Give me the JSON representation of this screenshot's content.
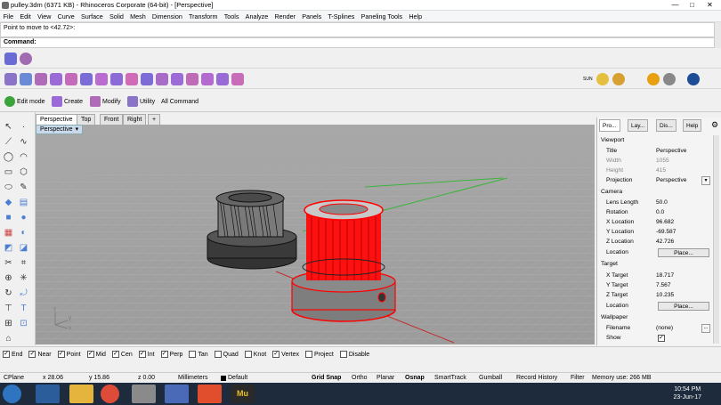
{
  "window": {
    "title": "pulley.3dm (6371 KB) - Rhinoceros Corporate (64-bit) - [Perspective]",
    "minimize": "—",
    "maximize": "□",
    "close": "✕"
  },
  "menu": [
    "File",
    "Edit",
    "View",
    "Curve",
    "Surface",
    "Solid",
    "Mesh",
    "Dimension",
    "Transform",
    "Tools",
    "Analyze",
    "Render",
    "Panels",
    "T-Splines",
    "Paneling Tools",
    "Help"
  ],
  "command": {
    "history": "Point to move to <42.72>:",
    "prompt": "Command:"
  },
  "tabs": {
    "edit_mode": "Edit mode",
    "create": "Create",
    "modify": "Modify",
    "utility": "Utility",
    "all_command": "All Command"
  },
  "sun_label": "SUN",
  "viewport_tabs": [
    "Perspective",
    "Top",
    "Front",
    "Right",
    "+"
  ],
  "viewport": {
    "label": "Perspective",
    "dropdown": "▾",
    "axis_z": "z",
    "axis_y": "y",
    "axis_x": "x"
  },
  "panel": {
    "tabs": [
      "Pro...",
      "Lay...",
      "Dis...",
      "Help"
    ],
    "sections": {
      "viewport": "Viewport",
      "camera": "Camera",
      "target": "Target",
      "wallpaper": "Wallpaper"
    },
    "viewport_rows": [
      {
        "k": "Title",
        "v": "Perspective"
      },
      {
        "k": "Width",
        "v": "1055"
      },
      {
        "k": "Height",
        "v": "415"
      },
      {
        "k": "Projection",
        "v": "Perspective"
      }
    ],
    "camera_rows": [
      {
        "k": "Lens Length",
        "v": "50.0"
      },
      {
        "k": "Rotation",
        "v": "0.0"
      },
      {
        "k": "X Location",
        "v": "96.682"
      },
      {
        "k": "Y Location",
        "v": "-69.587"
      },
      {
        "k": "Z Location",
        "v": "42.726"
      },
      {
        "k": "Location",
        "v": "Place..."
      }
    ],
    "target_rows": [
      {
        "k": "X Target",
        "v": "18.717"
      },
      {
        "k": "Y Target",
        "v": "7.567"
      },
      {
        "k": "Z Target",
        "v": "10.235"
      },
      {
        "k": "Location",
        "v": "Place..."
      }
    ],
    "wallpaper_rows": [
      {
        "k": "Filename",
        "v": "(none)"
      },
      {
        "k": "Show",
        "v": "✓"
      }
    ],
    "browse": "..."
  },
  "osnap": [
    {
      "label": "End",
      "checked": true
    },
    {
      "label": "Near",
      "checked": true
    },
    {
      "label": "Point",
      "checked": true
    },
    {
      "label": "Mid",
      "checked": true
    },
    {
      "label": "Cen",
      "checked": true
    },
    {
      "label": "Int",
      "checked": true
    },
    {
      "label": "Perp",
      "checked": true
    },
    {
      "label": "Tan",
      "checked": false
    },
    {
      "label": "Quad",
      "checked": false
    },
    {
      "label": "Knot",
      "checked": false
    },
    {
      "label": "Vertex",
      "checked": true
    },
    {
      "label": "Project",
      "checked": false
    },
    {
      "label": "Disable",
      "checked": false
    }
  ],
  "status": {
    "cplane": "CPlane",
    "x": "x 28.06",
    "y": "y 15.86",
    "z": "z 0.00",
    "units": "Millimeters",
    "layer": "Default",
    "grid_snap": "Grid Snap",
    "ortho": "Ortho",
    "planar": "Planar",
    "osnap": "Osnap",
    "smarttrack": "SmartTrack",
    "gumball": "Gumball",
    "record_history": "Record History",
    "filter": "Filter",
    "memory": "Memory use: 266 MB"
  },
  "clock": {
    "time": "10:54 PM",
    "date": "23-Jun-17"
  },
  "colors": {
    "accent": "#c8d8ec",
    "selection": "#ff0000",
    "grid_bg": "#a9a9a9"
  }
}
